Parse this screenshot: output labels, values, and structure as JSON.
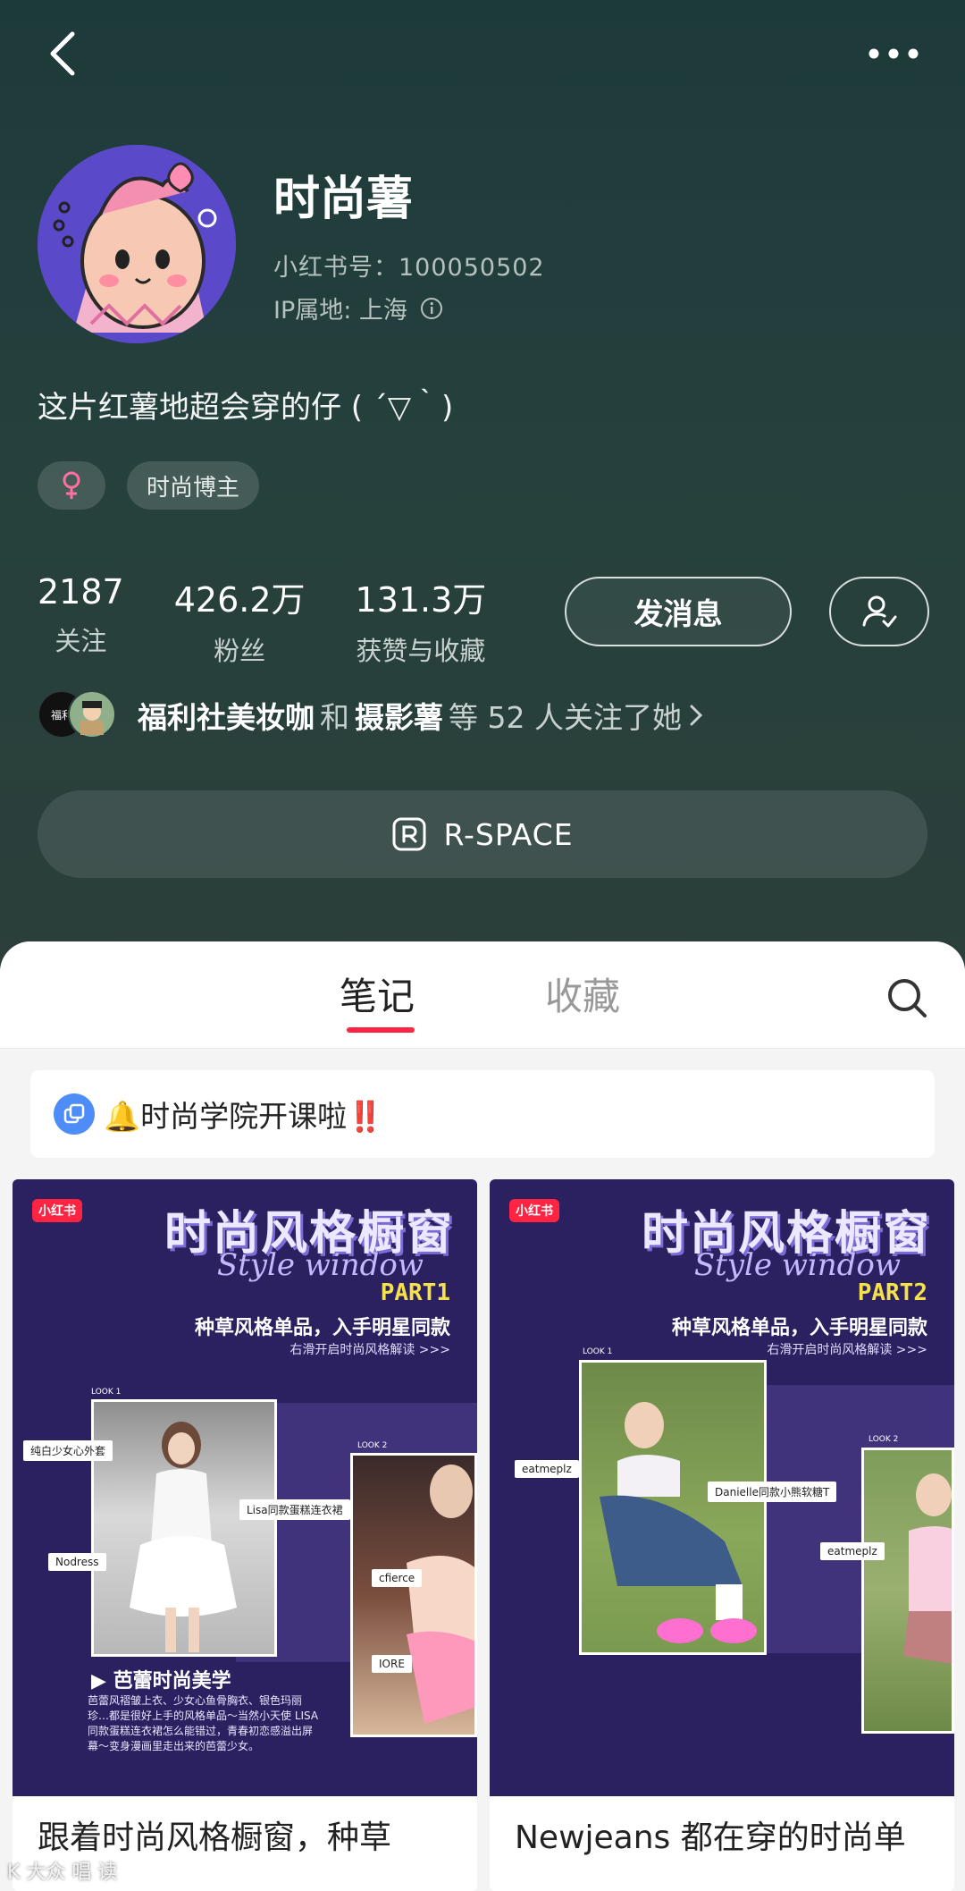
{
  "profile": {
    "name": "时尚薯",
    "redbook_id": "小红书号：100050502",
    "ip": "IP属地: 上海",
    "bio": "这片红薯地超会穿的仔 ( ´▽｀)",
    "tags": [
      "时尚博主"
    ]
  },
  "stats": [
    {
      "num": "2187",
      "label": "关注"
    },
    {
      "num": "426.2万",
      "label": "粉丝"
    },
    {
      "num": "131.3万",
      "label": "获赞与收藏"
    }
  ],
  "actions": {
    "message": "发消息"
  },
  "mutual": {
    "name1": "福利社美妆咖",
    "and": "和",
    "name2": "摄影薯",
    "suffix": "等 52 人关注了她",
    "mini_avatar_text": "福利"
  },
  "rspace": {
    "label": "R-SPACE"
  },
  "tabs": {
    "notes": "笔记",
    "collect": "收藏"
  },
  "pinned": {
    "label": "🔔时尚学院开课啦‼️"
  },
  "cards": [
    {
      "logo": "小红书",
      "title": "时尚风格橱窗",
      "script": "Style window",
      "part": "PART1",
      "subtitle": "种草风格单品，入手明星同款",
      "hint": "右滑开启时尚风格解读 >>>",
      "look1": "LOOK 1",
      "look2": "LOOK 2",
      "chips": [
        "纯白少女心外套",
        "Lisa同款蛋糕连衣裙",
        "Nodress",
        "cfierce",
        "IORE"
      ],
      "body_title": "▶ 芭蕾时尚美学",
      "body_text": "芭蕾风褶皱上衣、少女心鱼骨胸衣、银色玛丽珍…都是很好上手的风格单品～当然小天使 LISA 同款蛋糕连衣裙怎么能错过，青春初恋感溢出屏幕～变身漫画里走出来的芭蕾少女。",
      "caption": "跟着时尚风格橱窗，种草"
    },
    {
      "logo": "小红书",
      "title": "时尚风格橱窗",
      "script": "Style window",
      "part": "PART2",
      "subtitle": "种草风格单品，入手明星同款",
      "hint": "右滑开启时尚风格解读 >>>",
      "look1": "LOOK 1",
      "look2": "LOOK 2",
      "chips": [
        "eatmeplz",
        "Danielle同款小熊软糖T",
        "eatmeplz"
      ],
      "caption": "Newjeans 都在穿的时尚单"
    }
  ],
  "watermark": "K  大众 唱 读",
  "colors": {
    "accent": "#ff2442",
    "header_bg": "#1d3a3a",
    "pin_icon": "#4e8cf7"
  }
}
